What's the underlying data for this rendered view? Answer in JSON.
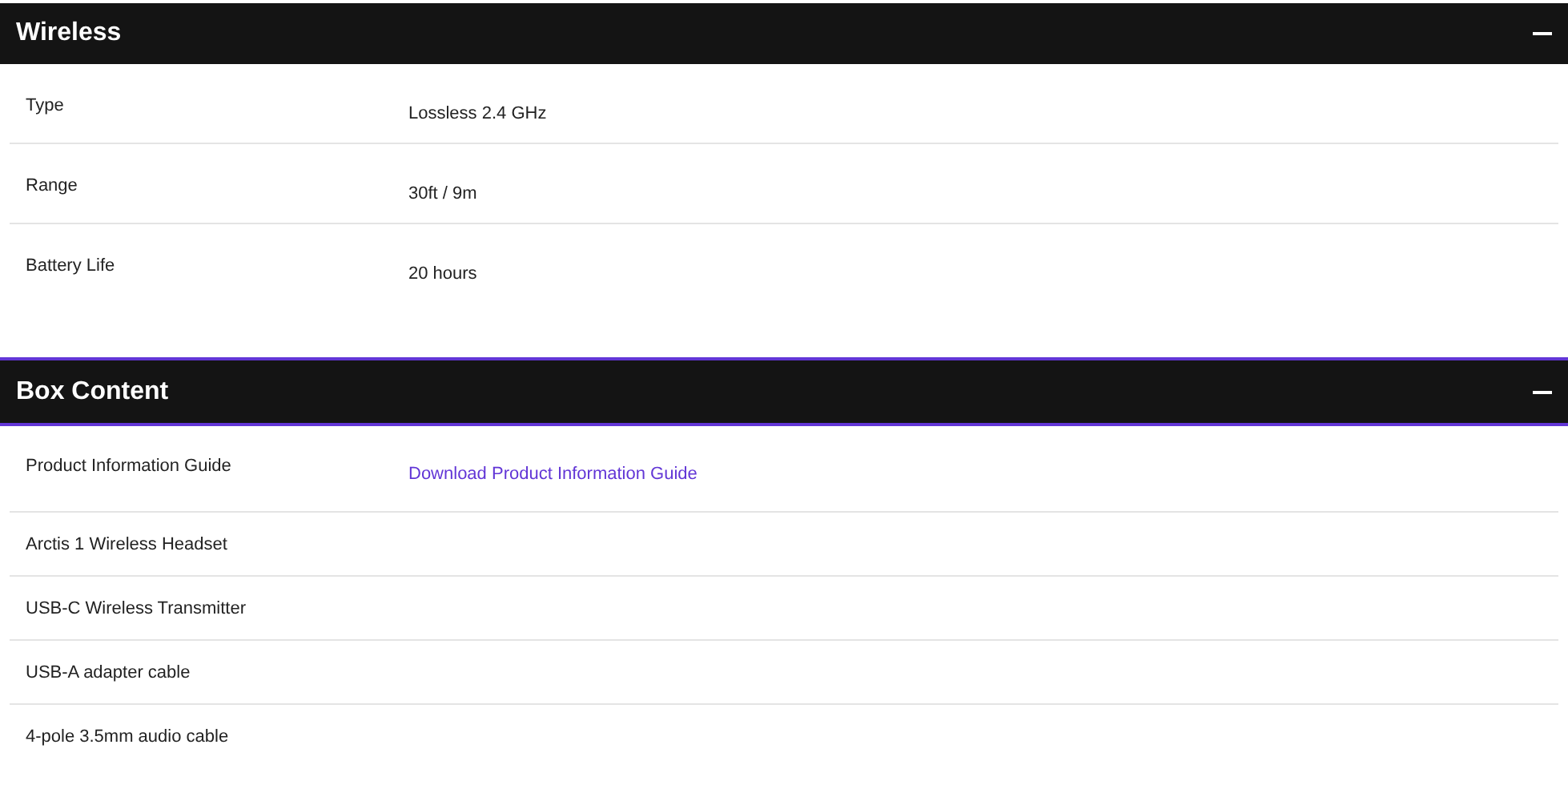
{
  "sections": [
    {
      "title": "Wireless",
      "expanded": true,
      "focused": false,
      "rows": [
        {
          "label": "Type",
          "value": {
            "kind": "text",
            "text": "Lossless 2.4 GHz"
          }
        },
        {
          "label": "Range",
          "value": {
            "kind": "text",
            "text": "30ft / 9m"
          }
        },
        {
          "label": "Battery Life",
          "value": {
            "kind": "text",
            "text": "20 hours"
          }
        }
      ]
    },
    {
      "title": "Box Content",
      "expanded": true,
      "focused": true,
      "rows": [
        {
          "label": "Product Information Guide",
          "value": {
            "kind": "link",
            "text": "Download Product Information Guide"
          }
        },
        {
          "label": "Arctis 1 Wireless Headset"
        },
        {
          "label": "USB-C Wireless Transmitter"
        },
        {
          "label": "USB-A adapter cable"
        },
        {
          "label": "4-pole 3.5mm audio cable"
        }
      ]
    }
  ]
}
